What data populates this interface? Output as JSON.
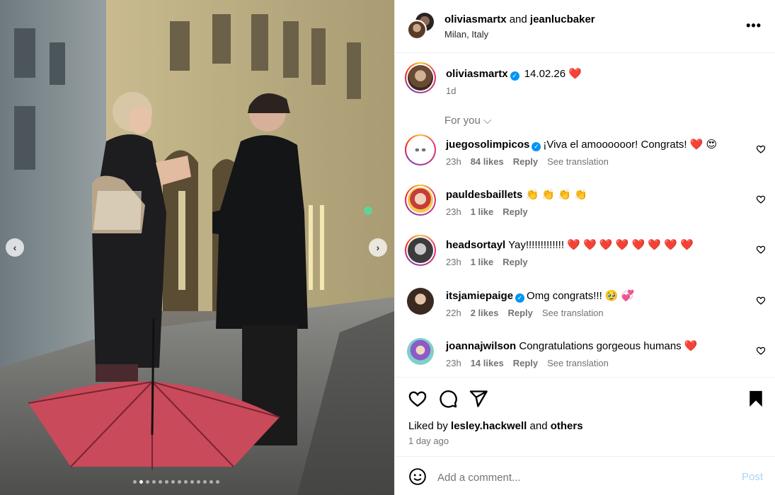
{
  "header": {
    "user1": "oliviasmartx",
    "and": "and",
    "user2": "jeanlucbaker",
    "location": "Milan, Italy",
    "more": "•••"
  },
  "caption": {
    "username": "oliviasmartx",
    "text": "14.02.26",
    "emoji": "❤️",
    "time": "1d"
  },
  "for_you": "For you ⌵",
  "comments": [
    {
      "username": "juegosolimpicos",
      "verified": true,
      "text": "¡Viva el amoooooor! Congrats! ❤️ 😍",
      "time": "23h",
      "likes": "84 likes",
      "reply": "Reply",
      "see": "See translation"
    },
    {
      "username": "pauldesbaillets",
      "verified": false,
      "text": "👏 👏 👏 👏",
      "time": "23h",
      "likes": "1 like",
      "reply": "Reply",
      "see": ""
    },
    {
      "username": "headsortayl",
      "verified": false,
      "text": "Yay!!!!!!!!!!!!! ❤️ ❤️ ❤️ ❤️ ❤️ ❤️ ❤️ ❤️",
      "time": "23h",
      "likes": "1 like",
      "reply": "Reply",
      "see": ""
    },
    {
      "username": "itsjamiepaige",
      "verified": true,
      "text": "Omg congrats!!! 🥹 💞",
      "time": "22h",
      "likes": "2 likes",
      "reply": "Reply",
      "see": "See translation"
    },
    {
      "username": "joannajwilson",
      "verified": false,
      "text": "Congratulations gorgeous humans ❤️",
      "time": "23h",
      "likes": "14 likes",
      "reply": "Reply",
      "see": "See translation"
    }
  ],
  "liked_by": {
    "prefix": "Liked by",
    "user": "lesley.hackwell",
    "and": "and",
    "others": "others"
  },
  "posted_ago": "1 day ago",
  "composer": {
    "placeholder": "Add a comment...",
    "post": "Post"
  },
  "carousel": {
    "total_slides": 14,
    "active_index": 1
  },
  "icons": {
    "like": "heart-icon",
    "comment": "comment-icon",
    "share": "send-icon",
    "save": "bookmark-icon",
    "emoji": "emoji-icon",
    "prev": "chevron-left-icon",
    "next": "chevron-right-icon"
  },
  "colors": {
    "verified": "#0095f6",
    "heart": "#ed2b5b",
    "muted": "#737373",
    "post_disabled": "#a9d4f5"
  }
}
